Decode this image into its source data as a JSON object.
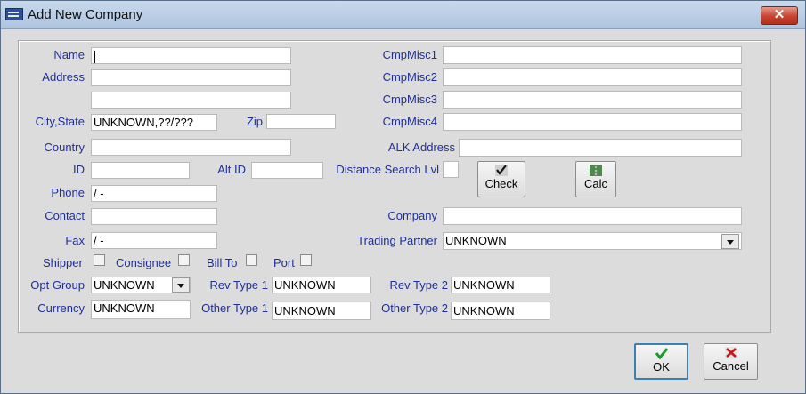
{
  "window": {
    "title": "Add New Company",
    "close_glyph": "✕"
  },
  "labels": {
    "name": "Name",
    "address": "Address",
    "city_state": "City,State",
    "zip": "Zip",
    "country": "Country",
    "id": "ID",
    "alt_id": "Alt ID",
    "distance_search_lvl": "Distance Search Lvl",
    "phone": "Phone",
    "contact": "Contact",
    "fax": "Fax",
    "shipper": "Shipper",
    "consignee": "Consignee",
    "bill_to": "Bill To",
    "port": "Port",
    "opt_group": "Opt Group",
    "rev_type1": "Rev Type 1",
    "rev_type2": "Rev Type 2",
    "currency": "Currency",
    "other_type1": "Other Type 1",
    "other_type2": "Other Type 2",
    "cmpmisc1": "CmpMisc1",
    "cmpmisc2": "CmpMisc2",
    "cmpmisc3": "CmpMisc3",
    "cmpmisc4": "CmpMisc4",
    "alk_address": "ALK Address",
    "company": "Company",
    "trading_partner": "Trading Partner"
  },
  "values": {
    "name": "",
    "address1": "",
    "address2": "",
    "city_state": "UNKNOWN,??/???",
    "zip": "",
    "country": "",
    "id": "",
    "alt_id": "",
    "distance_search_lvl": "",
    "phone": " /  -",
    "contact": "",
    "fax": " /  -",
    "opt_group": "UNKNOWN",
    "rev_type1": "UNKNOWN",
    "rev_type2": "UNKNOWN",
    "currency": "UNKNOWN",
    "other_type1": "UNKNOWN",
    "other_type2": "UNKNOWN",
    "cmpmisc1": "",
    "cmpmisc2": "",
    "cmpmisc3": "",
    "cmpmisc4": "",
    "alk_address": "",
    "company": "",
    "trading_partner": "UNKNOWN"
  },
  "checkboxes": {
    "shipper": false,
    "consignee": false,
    "bill_to": false,
    "port": false
  },
  "buttons": {
    "check": "Check",
    "calc": "Calc",
    "ok": "OK",
    "cancel": "Cancel"
  },
  "icons": {
    "check": "checkmark-icon",
    "calc": "road-icon",
    "ok": "green-check-icon",
    "cancel": "red-x-icon"
  }
}
